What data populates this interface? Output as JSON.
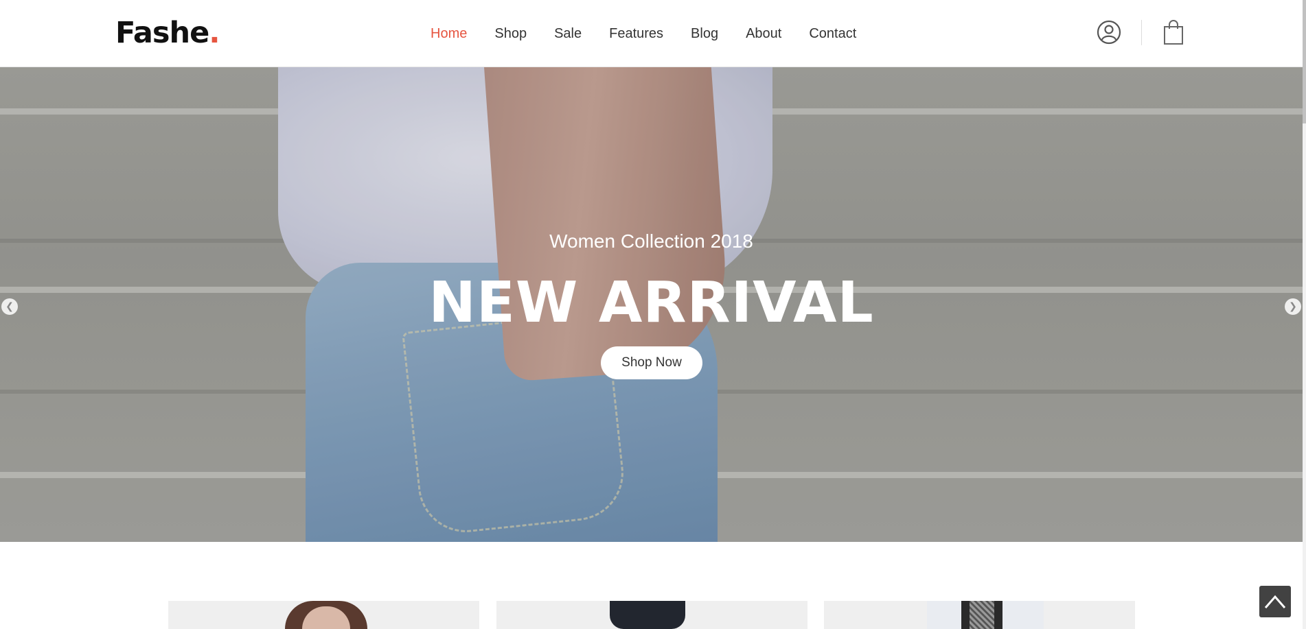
{
  "brand": {
    "name": "Fashe",
    "dot": ".",
    "accent": "#e65540"
  },
  "nav": {
    "items": [
      {
        "label": "Home",
        "active": true
      },
      {
        "label": "Shop",
        "active": false
      },
      {
        "label": "Sale",
        "active": false
      },
      {
        "label": "Features",
        "active": false
      },
      {
        "label": "Blog",
        "active": false
      },
      {
        "label": "About",
        "active": false
      },
      {
        "label": "Contact",
        "active": false
      }
    ]
  },
  "header_icons": {
    "account": "user-icon",
    "cart": "shopping-bag-icon"
  },
  "hero": {
    "subtitle": "Women Collection 2018",
    "title": "NEW ARRIVAL",
    "button_label": "Shop Now",
    "prev_icon": "chevron-left-icon",
    "next_icon": "chevron-right-icon"
  },
  "back_to_top_icon": "chevron-up-icon"
}
